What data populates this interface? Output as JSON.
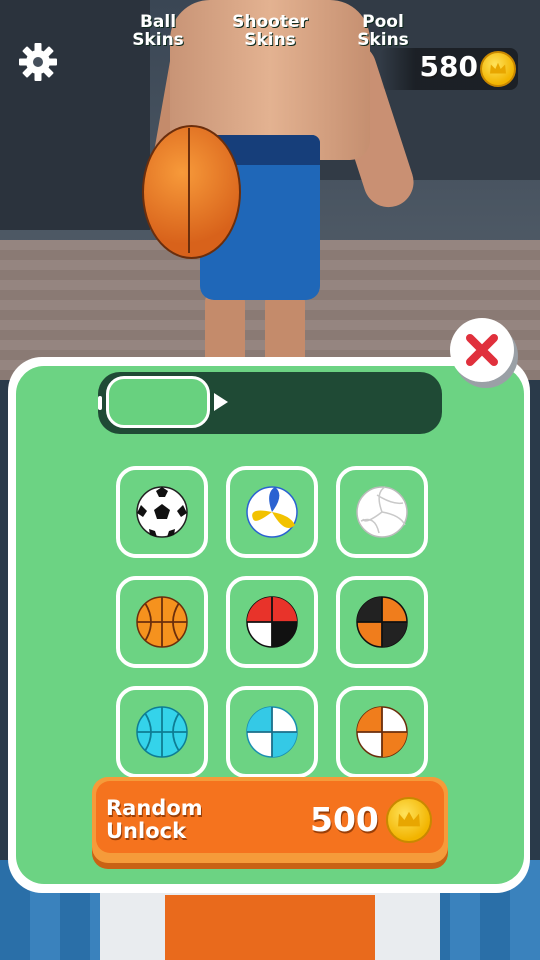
{
  "hud": {
    "coins": "580",
    "settings_icon": "gear-icon",
    "coin_icon": "coin-crown-icon"
  },
  "close_icon": "close-x-icon",
  "tabs": [
    {
      "label": "Ball\nSkins",
      "active": true
    },
    {
      "label": "Shooter\nSkins",
      "active": false
    },
    {
      "label": "Pool\nSkins",
      "active": false
    }
  ],
  "skins": [
    {
      "name": "soccer-ball",
      "colors": [
        "#ffffff",
        "#111111"
      ]
    },
    {
      "name": "volleyball-yellow-blue",
      "colors": [
        "#ffffff",
        "#f2c200",
        "#2a62d1"
      ]
    },
    {
      "name": "volleyball-white",
      "colors": [
        "#ffffff",
        "#dddddd"
      ]
    },
    {
      "name": "basketball-orange",
      "colors": [
        "#f5921e",
        "#6b2e0c"
      ]
    },
    {
      "name": "basketball-red-white-black",
      "colors": [
        "#e8332a",
        "#ffffff",
        "#111111"
      ]
    },
    {
      "name": "basketball-black-orange",
      "colors": [
        "#222222",
        "#f07d1c"
      ]
    },
    {
      "name": "basketball-cyan",
      "colors": [
        "#34d3ea",
        "#0e7d94"
      ]
    },
    {
      "name": "basketball-white-cyan",
      "colors": [
        "#ffffff",
        "#34c9e6"
      ]
    },
    {
      "name": "basketball-orange-white",
      "colors": [
        "#f07d1c",
        "#ffffff"
      ]
    }
  ],
  "random_unlock": {
    "label": "Random\nUnlock",
    "price": "500"
  },
  "colors": {
    "panel_green": "#6cd383",
    "tab_bar": "#1f4a35",
    "button_orange": "#f5731e",
    "coin_gold": "#f2b400",
    "close_red": "#e0303c"
  }
}
